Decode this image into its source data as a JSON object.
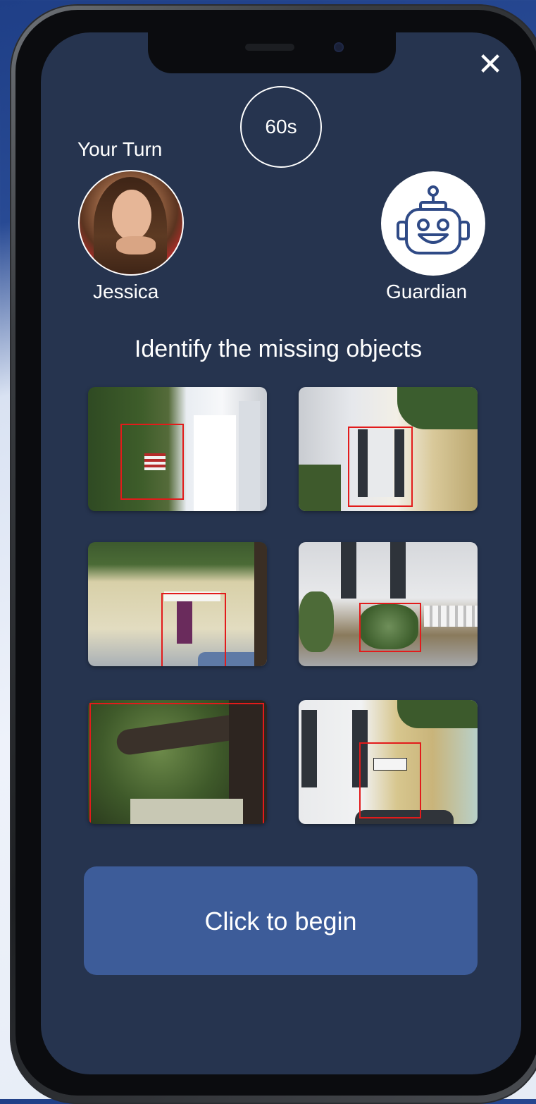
{
  "header": {
    "close_label": "✕",
    "timer_text": "60s"
  },
  "player": {
    "turn_label": "Your Turn",
    "name": "Jessica"
  },
  "opponent": {
    "name": "Guardian",
    "icon": "robot-icon"
  },
  "game": {
    "prompt": "Identify the missing objects",
    "photos": [
      {
        "name": "photo-flag"
      },
      {
        "name": "photo-window"
      },
      {
        "name": "photo-door"
      },
      {
        "name": "photo-bush"
      },
      {
        "name": "photo-tree"
      },
      {
        "name": "photo-sign"
      }
    ]
  },
  "actions": {
    "begin_label": "Click to begin"
  },
  "colors": {
    "screen_bg": "#26344f",
    "button_bg": "#3d5c99",
    "highlight": "#e21b1b",
    "text": "#ffffff"
  }
}
